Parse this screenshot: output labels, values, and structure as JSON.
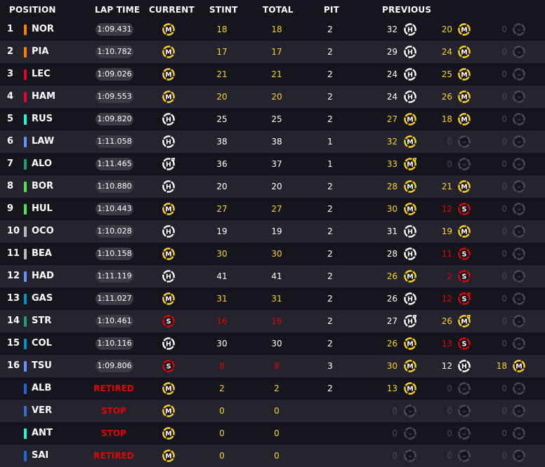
{
  "headers": {
    "position": "POSITION",
    "lap_time": "LAP TIME",
    "current": "CURRENT",
    "stint": "STINT",
    "total": "TOTAL",
    "pit": "PIT",
    "previous": "PREVIOUS"
  },
  "colors": {
    "white": "#ffffff",
    "yellow": "#ffd21e",
    "red": "#e10600",
    "dim": "#4a4a58",
    "medium": "#ffd21e",
    "hard": "#ffffff",
    "soft": "#e10600",
    "none": "#4a4a58"
  },
  "rows": [
    {
      "pos": "1",
      "code": "NOR",
      "team_color": "#ff8000",
      "lap": "1:09.431",
      "status": "",
      "cur": "M",
      "stint": "18",
      "total": "18",
      "sc": "yellow",
      "pit": "2",
      "prev": [
        {
          "v": "32",
          "t": "H",
          "c": "white"
        },
        {
          "v": "20",
          "t": "M",
          "c": "yellow"
        },
        {
          "v": "0",
          "t": "-",
          "c": "dim"
        }
      ]
    },
    {
      "pos": "2",
      "code": "PIA",
      "team_color": "#ff8000",
      "lap": "1:10.782",
      "status": "",
      "cur": "M",
      "stint": "17",
      "total": "17",
      "sc": "yellow",
      "pit": "2",
      "prev": [
        {
          "v": "29",
          "t": "H",
          "c": "white"
        },
        {
          "v": "24",
          "t": "M",
          "c": "yellow"
        },
        {
          "v": "0",
          "t": "-",
          "c": "dim"
        }
      ]
    },
    {
      "pos": "3",
      "code": "LEC",
      "team_color": "#e8002d",
      "lap": "1:09.026",
      "status": "",
      "cur": "M",
      "stint": "21",
      "total": "21",
      "sc": "yellow",
      "pit": "2",
      "prev": [
        {
          "v": "24",
          "t": "H",
          "c": "white"
        },
        {
          "v": "25",
          "t": "M",
          "c": "yellow"
        },
        {
          "v": "0",
          "t": "-",
          "c": "dim"
        }
      ]
    },
    {
      "pos": "4",
      "code": "HAM",
      "team_color": "#e8002d",
      "lap": "1:09.553",
      "status": "",
      "cur": "M",
      "stint": "20",
      "total": "20",
      "sc": "yellow",
      "pit": "2",
      "prev": [
        {
          "v": "24",
          "t": "H",
          "c": "white"
        },
        {
          "v": "26",
          "t": "M",
          "c": "yellow"
        },
        {
          "v": "0",
          "t": "-",
          "c": "dim"
        }
      ]
    },
    {
      "pos": "5",
      "code": "RUS",
      "team_color": "#27f4d2",
      "lap": "1:09.820",
      "status": "",
      "cur": "H",
      "stint": "25",
      "total": "25",
      "sc": "white",
      "pit": "2",
      "prev": [
        {
          "v": "27",
          "t": "M",
          "c": "yellow"
        },
        {
          "v": "18",
          "t": "M",
          "c": "yellow"
        },
        {
          "v": "0",
          "t": "-",
          "c": "dim"
        }
      ]
    },
    {
      "pos": "6",
      "code": "LAW",
      "team_color": "#6692ff",
      "lap": "1:11.058",
      "status": "",
      "cur": "H",
      "stint": "38",
      "total": "38",
      "sc": "white",
      "pit": "1",
      "prev": [
        {
          "v": "32",
          "t": "M",
          "c": "yellow"
        },
        {
          "v": "0",
          "t": "-",
          "c": "dim"
        },
        {
          "v": "0",
          "t": "-",
          "c": "dim"
        }
      ]
    },
    {
      "pos": "7",
      "code": "ALO",
      "team_color": "#229971",
      "lap": "1:11.465",
      "status": "",
      "cur": "Hu",
      "stint": "36",
      "total": "37",
      "sc": "white",
      "pit": "1",
      "prev": [
        {
          "v": "33",
          "t": "Mu",
          "c": "yellow"
        },
        {
          "v": "0",
          "t": "-",
          "c": "dim"
        },
        {
          "v": "0",
          "t": "-",
          "c": "dim"
        }
      ]
    },
    {
      "pos": "8",
      "code": "BOR",
      "team_color": "#52e252",
      "lap": "1:10.880",
      "status": "",
      "cur": "H",
      "stint": "20",
      "total": "20",
      "sc": "white",
      "pit": "2",
      "prev": [
        {
          "v": "28",
          "t": "M",
          "c": "yellow"
        },
        {
          "v": "21",
          "t": "M",
          "c": "yellow"
        },
        {
          "v": "0",
          "t": "-",
          "c": "dim"
        }
      ]
    },
    {
      "pos": "9",
      "code": "HUL",
      "team_color": "#52e252",
      "lap": "1:10.443",
      "status": "",
      "cur": "M",
      "stint": "27",
      "total": "27",
      "sc": "yellow",
      "pit": "2",
      "prev": [
        {
          "v": "30",
          "t": "M",
          "c": "yellow"
        },
        {
          "v": "12",
          "t": "S",
          "c": "red"
        },
        {
          "v": "0",
          "t": "-",
          "c": "dim"
        }
      ]
    },
    {
      "pos": "10",
      "code": "OCO",
      "team_color": "#b6babd",
      "lap": "1:10.028",
      "status": "",
      "cur": "H",
      "stint": "19",
      "total": "19",
      "sc": "white",
      "pit": "2",
      "prev": [
        {
          "v": "31",
          "t": "H",
          "c": "white"
        },
        {
          "v": "19",
          "t": "M",
          "c": "yellow"
        },
        {
          "v": "0",
          "t": "-",
          "c": "dim"
        }
      ]
    },
    {
      "pos": "11",
      "code": "BEA",
      "team_color": "#b6babd",
      "lap": "1:10.158",
      "status": "",
      "cur": "M",
      "stint": "30",
      "total": "30",
      "sc": "yellow",
      "pit": "2",
      "prev": [
        {
          "v": "28",
          "t": "H",
          "c": "white"
        },
        {
          "v": "11",
          "t": "S",
          "c": "red"
        },
        {
          "v": "0",
          "t": "-",
          "c": "dim"
        }
      ]
    },
    {
      "pos": "12",
      "code": "HAD",
      "team_color": "#6692ff",
      "lap": "1:11.119",
      "status": "",
      "cur": "H",
      "stint": "41",
      "total": "41",
      "sc": "white",
      "pit": "2",
      "prev": [
        {
          "v": "26",
          "t": "M",
          "c": "yellow"
        },
        {
          "v": "2",
          "t": "S",
          "c": "red"
        },
        {
          "v": "0",
          "t": "-",
          "c": "dim"
        }
      ]
    },
    {
      "pos": "13",
      "code": "GAS",
      "team_color": "#0093cc",
      "lap": "1:11.027",
      "status": "",
      "cur": "M",
      "stint": "31",
      "total": "31",
      "sc": "yellow",
      "pit": "2",
      "prev": [
        {
          "v": "26",
          "t": "H",
          "c": "white"
        },
        {
          "v": "12",
          "t": "Su",
          "c": "red"
        },
        {
          "v": "0",
          "t": "-",
          "c": "dim"
        }
      ]
    },
    {
      "pos": "14",
      "code": "STR",
      "team_color": "#229971",
      "lap": "1:10.461",
      "status": "",
      "cur": "S",
      "stint": "16",
      "total": "16",
      "sc": "red",
      "pit": "2",
      "prev": [
        {
          "v": "27",
          "t": "Hu",
          "c": "white"
        },
        {
          "v": "26",
          "t": "Mu",
          "c": "yellow"
        },
        {
          "v": "0",
          "t": "-",
          "c": "dim"
        }
      ]
    },
    {
      "pos": "15",
      "code": "COL",
      "team_color": "#0093cc",
      "lap": "1:10.116",
      "status": "",
      "cur": "H",
      "stint": "30",
      "total": "30",
      "sc": "white",
      "pit": "2",
      "prev": [
        {
          "v": "26",
          "t": "M",
          "c": "yellow"
        },
        {
          "v": "13",
          "t": "S",
          "c": "red"
        },
        {
          "v": "0",
          "t": "-",
          "c": "dim"
        }
      ]
    },
    {
      "pos": "16",
      "code": "TSU",
      "team_color": "#6692ff",
      "lap": "1:09.806",
      "status": "",
      "cur": "S",
      "stint": "8",
      "total": "8",
      "sc": "red",
      "pit": "3",
      "prev": [
        {
          "v": "30",
          "t": "M",
          "c": "yellow"
        },
        {
          "v": "12",
          "t": "H",
          "c": "white"
        },
        {
          "v": "18",
          "t": "M",
          "c": "yellow"
        }
      ]
    },
    {
      "pos": "",
      "code": "ALB",
      "team_color": "#1868db",
      "lap": "",
      "status": "RETIRED",
      "cur": "M",
      "stint": "2",
      "total": "2",
      "sc": "yellow",
      "pit": "2",
      "prev": [
        {
          "v": "13",
          "t": "M",
          "c": "yellow"
        },
        {
          "v": "0",
          "t": "-",
          "c": "dim"
        },
        {
          "v": "0",
          "t": "-",
          "c": "dim"
        }
      ]
    },
    {
      "pos": "",
      "code": "VER",
      "team_color": "#3671c6",
      "lap": "",
      "status": "STOP",
      "cur": "M",
      "stint": "0",
      "total": "0",
      "sc": "yellow",
      "pit": "",
      "prev": [
        {
          "v": "0",
          "t": "-",
          "c": "dim"
        },
        {
          "v": "0",
          "t": "-",
          "c": "dim"
        },
        {
          "v": "0",
          "t": "-",
          "c": "dim"
        }
      ]
    },
    {
      "pos": "",
      "code": "ANT",
      "team_color": "#27f4d2",
      "lap": "",
      "status": "STOP",
      "cur": "M",
      "stint": "0",
      "total": "0",
      "sc": "yellow",
      "pit": "",
      "prev": [
        {
          "v": "0",
          "t": "-",
          "c": "dim"
        },
        {
          "v": "0",
          "t": "-",
          "c": "dim"
        },
        {
          "v": "0",
          "t": "-",
          "c": "dim"
        }
      ]
    },
    {
      "pos": "",
      "code": "SAI",
      "team_color": "#1868db",
      "lap": "",
      "status": "RETIRED",
      "cur": "M",
      "stint": "0",
      "total": "0",
      "sc": "yellow",
      "pit": "",
      "prev": [
        {
          "v": "0",
          "t": "-",
          "c": "dim"
        },
        {
          "v": "0",
          "t": "-",
          "c": "dim"
        },
        {
          "v": "0",
          "t": "-",
          "c": "dim"
        }
      ]
    }
  ]
}
